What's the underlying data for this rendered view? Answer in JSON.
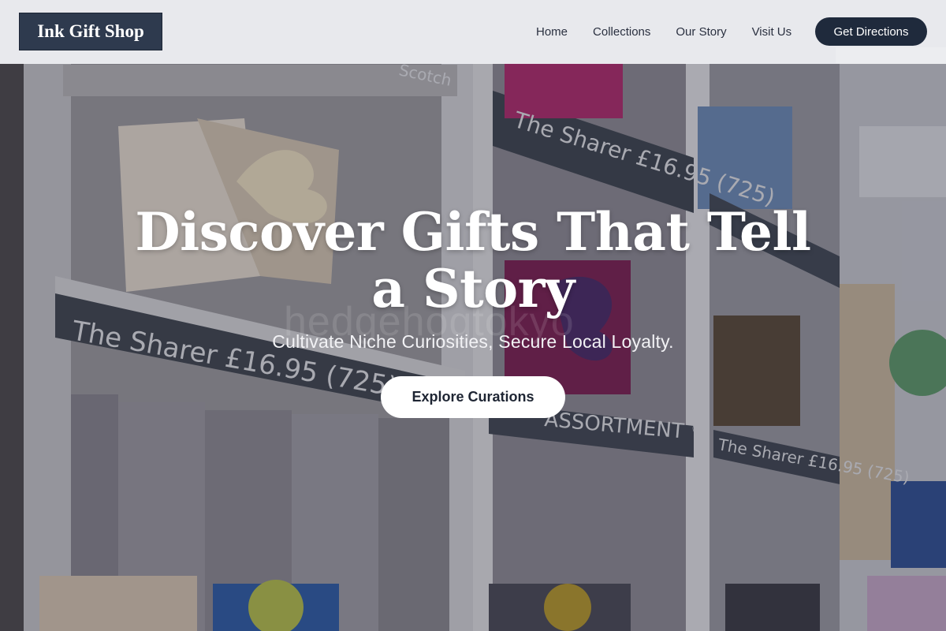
{
  "header": {
    "logo": "Ink Gift Shop",
    "nav": [
      "Home",
      "Collections",
      "Our Story",
      "Visit Us"
    ],
    "cta": "Get Directions"
  },
  "hero": {
    "title": "Discover Gifts That Tell a Story",
    "subtitle": "Cultivate Niche Curiosities, Secure Local Loyalty.",
    "button": "Explore Curations",
    "watermark": "hedgehogtokyo"
  },
  "shelf_labels": [
    "The Sharer £16.95 (725)",
    "The Sharer £16.95 (725)",
    "The Sharer £16.95 (725)",
    "ASSORTMENT ♡",
    "Scotch"
  ],
  "colors": {
    "logo_bg": "#2e3a4e",
    "cta_bg": "#1f2a3c",
    "button_bg": "#ffffff",
    "title_color": "#ffffff"
  }
}
